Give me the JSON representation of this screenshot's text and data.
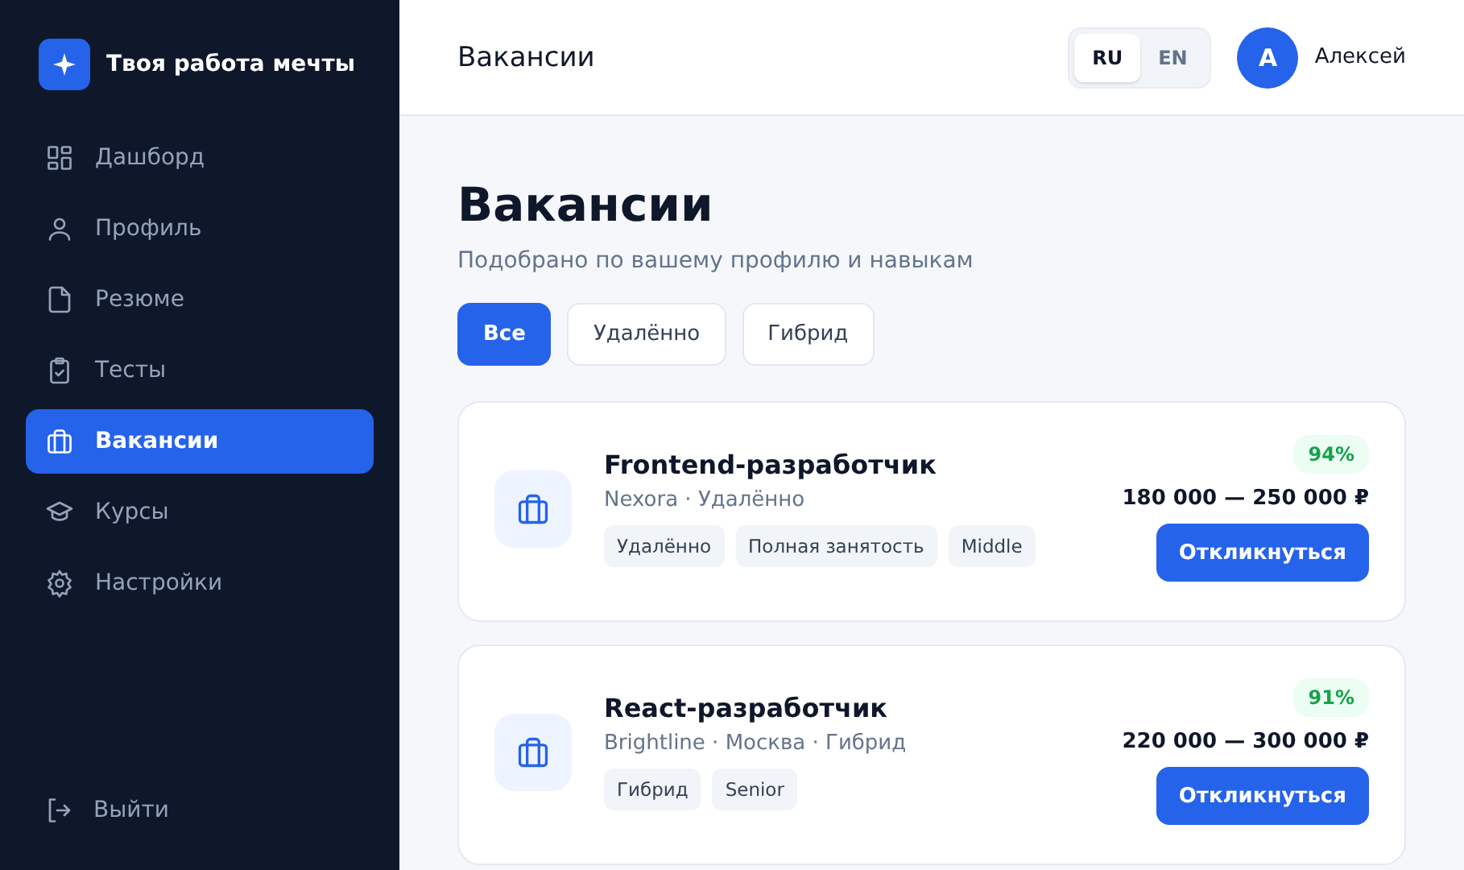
{
  "brand": {
    "name": "Твоя работа мечты"
  },
  "sidebar": {
    "items": [
      {
        "label": "Дашборд",
        "selected": false
      },
      {
        "label": "Профиль",
        "selected": false
      },
      {
        "label": "Резюме",
        "selected": false
      },
      {
        "label": "Тесты",
        "selected": false
      },
      {
        "label": "Вакансии",
        "selected": true
      },
      {
        "label": "Курсы",
        "selected": false
      },
      {
        "label": "Настройки",
        "selected": false
      }
    ],
    "logout": "Выйти"
  },
  "header": {
    "title": "Вакансии",
    "languages": [
      {
        "label": "RU",
        "selected": true
      },
      {
        "label": "EN",
        "selected": false
      }
    ],
    "user": {
      "initial": "А",
      "name": "Алексей"
    }
  },
  "page": {
    "title": "Вакансии",
    "subtitle": "Подобрано по вашему профилю и навыкам"
  },
  "filters": [
    {
      "label": "Все",
      "selected": true
    },
    {
      "label": "Удалённо",
      "selected": false
    },
    {
      "label": "Гибрид",
      "selected": false
    }
  ],
  "jobs": [
    {
      "title": "Frontend-разработчик",
      "meta": "Nexora · Удалённо",
      "tags": [
        "Удалённо",
        "Полная занятость",
        "Middle"
      ],
      "match": "94%",
      "salary": "180 000 — 250 000 ₽",
      "action": "Откликнуться"
    },
    {
      "title": "React-разработчик",
      "meta": "Brightline · Москва · Гибрид",
      "tags": [
        "Гибрид",
        "Senior"
      ],
      "match": "91%",
      "salary": "220 000 — 300 000 ₽",
      "action": "Откликнуться"
    }
  ]
}
